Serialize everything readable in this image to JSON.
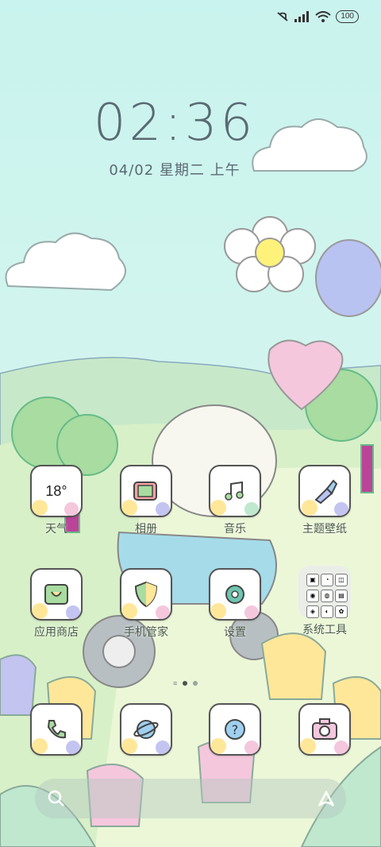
{
  "status_bar": {
    "battery": "100"
  },
  "clock": {
    "time": "02:36",
    "date": "04/02 星期二 上午"
  },
  "apps": [
    {
      "label": "天气",
      "icon": "weather-icon",
      "text": "18°"
    },
    {
      "label": "相册",
      "icon": "gallery-icon"
    },
    {
      "label": "音乐",
      "icon": "music-icon"
    },
    {
      "label": "主题壁纸",
      "icon": "theme-brush-icon"
    },
    {
      "label": "应用商店",
      "icon": "app-store-icon"
    },
    {
      "label": "手机管家",
      "icon": "security-shield-icon"
    },
    {
      "label": "设置",
      "icon": "settings-gear-icon"
    },
    {
      "label": "系统工具",
      "icon": "folder-icon"
    }
  ],
  "dock": [
    {
      "icon": "phone-icon"
    },
    {
      "icon": "browser-planet-icon"
    },
    {
      "icon": "help-icon"
    },
    {
      "icon": "camera-icon"
    }
  ],
  "page_indicator": {
    "pages": 2,
    "active": 1
  },
  "colors": {
    "sky": "#c9f0ee",
    "hills": "#bfe6c8",
    "text": "#5a6a73"
  }
}
